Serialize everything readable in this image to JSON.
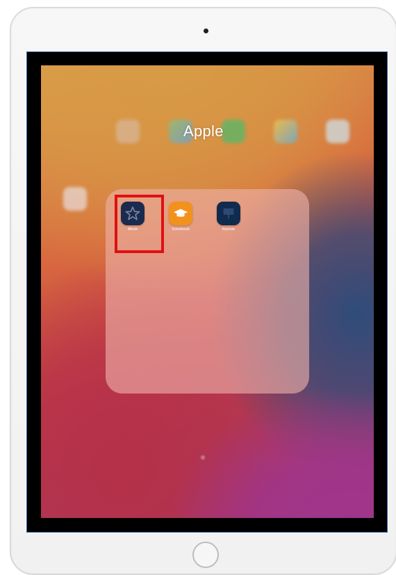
{
  "folder": {
    "title": "Apple",
    "apps": [
      {
        "name": "iMovie",
        "label": "iMovie",
        "icon": "star-icon",
        "color": "#1b2b4e",
        "highlighted": true
      },
      {
        "name": "Schoolwork",
        "label": "Schoolwork",
        "icon": "graduation-cap-icon",
        "color": "#f2921d",
        "highlighted": false
      },
      {
        "name": "Keynote",
        "label": "Keynote",
        "icon": "presentation-icon",
        "color": "#102b4e",
        "highlighted": false
      }
    ]
  },
  "background_icons": [
    "app-icon",
    "maps-icon",
    "messages-icon",
    "photos-icon",
    "app-icon",
    "app-icon"
  ],
  "colors": {
    "highlight": "#e01010",
    "bezel_outline": "#3b64a6"
  }
}
